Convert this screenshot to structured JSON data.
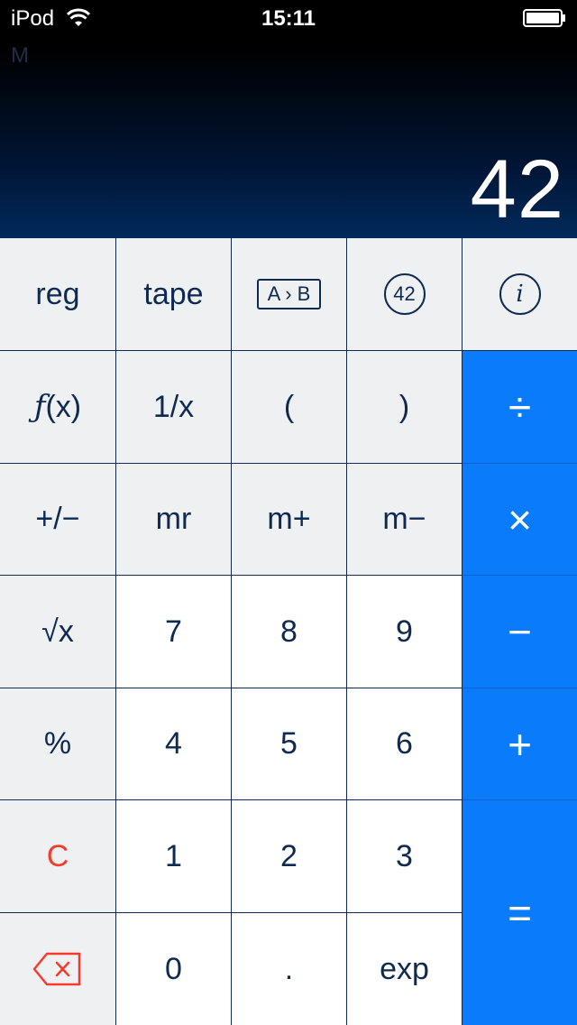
{
  "status_bar": {
    "carrier": "iPod",
    "time": "15:11"
  },
  "display": {
    "memory_indicator": "M",
    "value": "42"
  },
  "keys": {
    "reg": "reg",
    "tape": "tape",
    "convert": "A › B",
    "answer": "42",
    "info": "i",
    "fx_f": "ƒ",
    "fx_rest": "(x)",
    "reciprocal": "1/x",
    "open_paren": "(",
    "close_paren": ")",
    "divide": "÷",
    "plus_minus": "+/−",
    "mr": "mr",
    "m_plus": "m+",
    "m_minus": "m−",
    "multiply": "×",
    "sqrt": "√x",
    "d7": "7",
    "d8": "8",
    "d9": "9",
    "minus": "−",
    "percent": "%",
    "d4": "4",
    "d5": "5",
    "d6": "6",
    "plus": "+",
    "clear": "C",
    "d1": "1",
    "d2": "2",
    "d3": "3",
    "equals": "=",
    "d0": "0",
    "dot": ".",
    "exp": "exp"
  },
  "colors": {
    "accent_blue": "#0a7bfb",
    "key_text": "#0e2a51",
    "clear_red": "#f53b2c",
    "function_key_bg": "#eff0f2"
  },
  "icons": [
    "wifi-icon",
    "battery-icon",
    "backspace-icon"
  ]
}
